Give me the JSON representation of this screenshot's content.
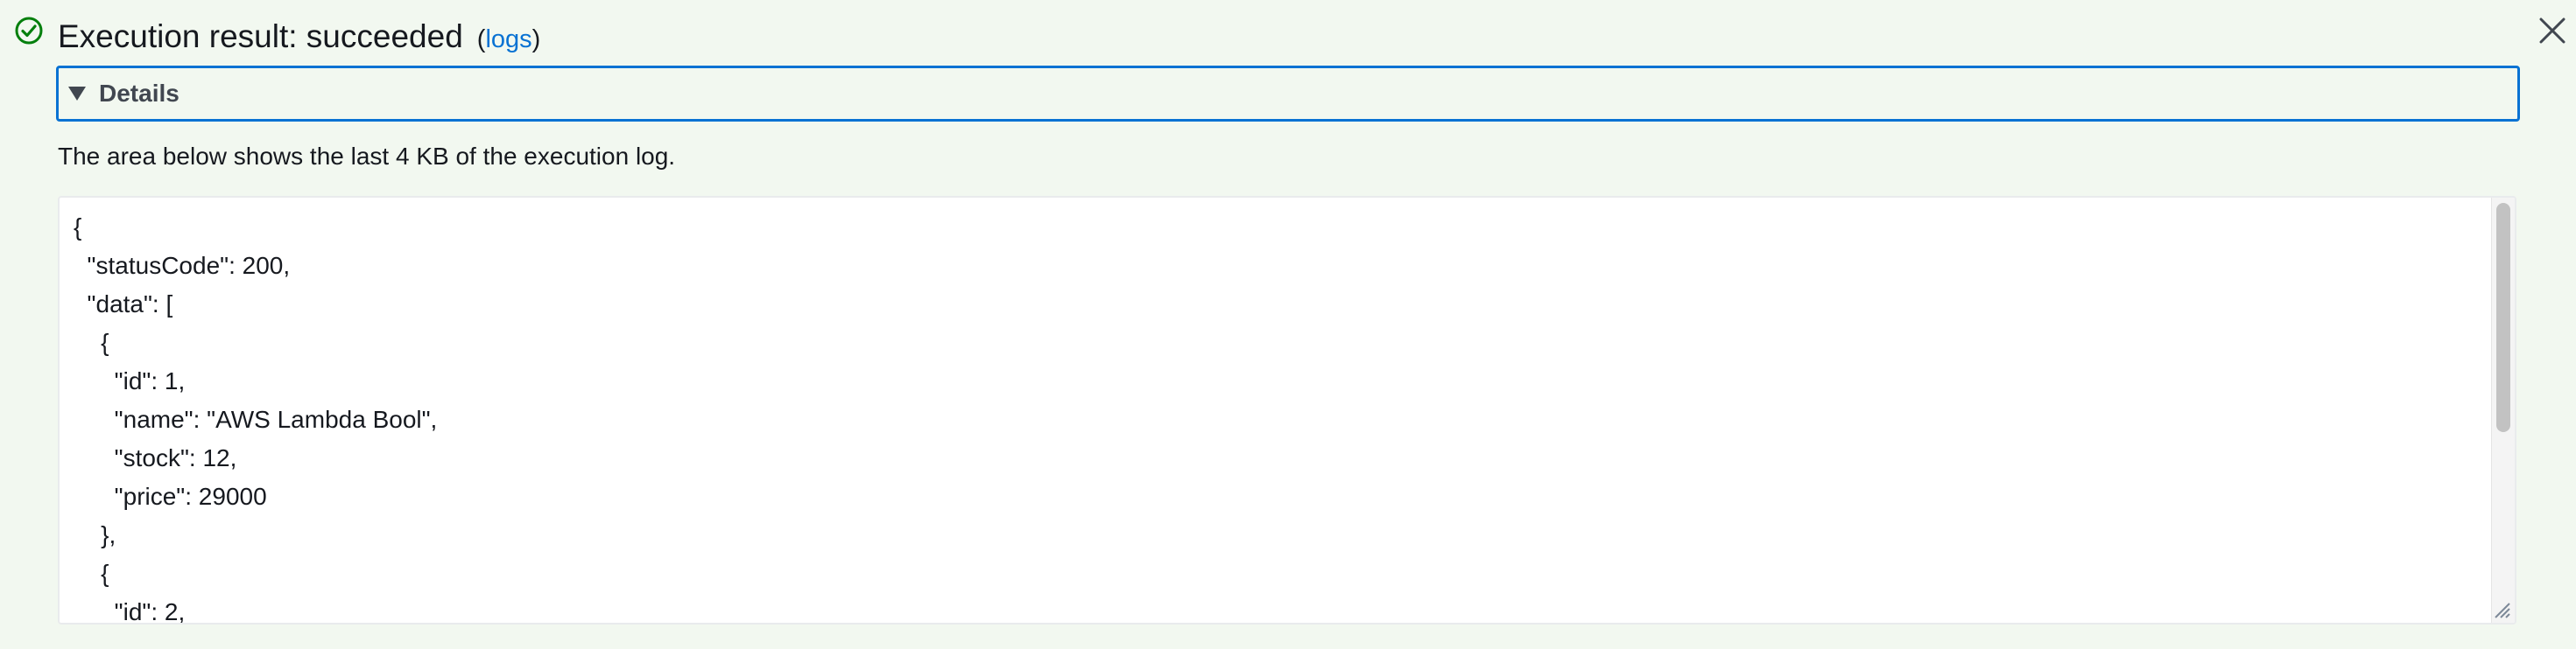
{
  "header": {
    "title": "Execution result: succeeded",
    "logs_open": "(",
    "logs_link": "logs",
    "logs_close": ")",
    "status_icon": "success-check-circle-icon",
    "status_color": "#037f0c",
    "close_icon": "close-icon"
  },
  "details": {
    "label": "Details",
    "expanded": true,
    "caret_icon": "caret-down-icon",
    "border_color": "#0972d3"
  },
  "description": "The area below shows the last 4 KB of the execution log.",
  "log": {
    "lines": [
      "{",
      "  \"statusCode\": 200,",
      "  \"data\": [",
      "    {",
      "      \"id\": 1,",
      "      \"name\": \"AWS Lambda Bool\",",
      "      \"stock\": 12,",
      "      \"price\": 29000",
      "    },",
      "    {",
      "      \"id\": 2,"
    ]
  },
  "colors": {
    "panel_background": "#f2f8f0",
    "link": "#0972d3",
    "text": "#16191f"
  }
}
